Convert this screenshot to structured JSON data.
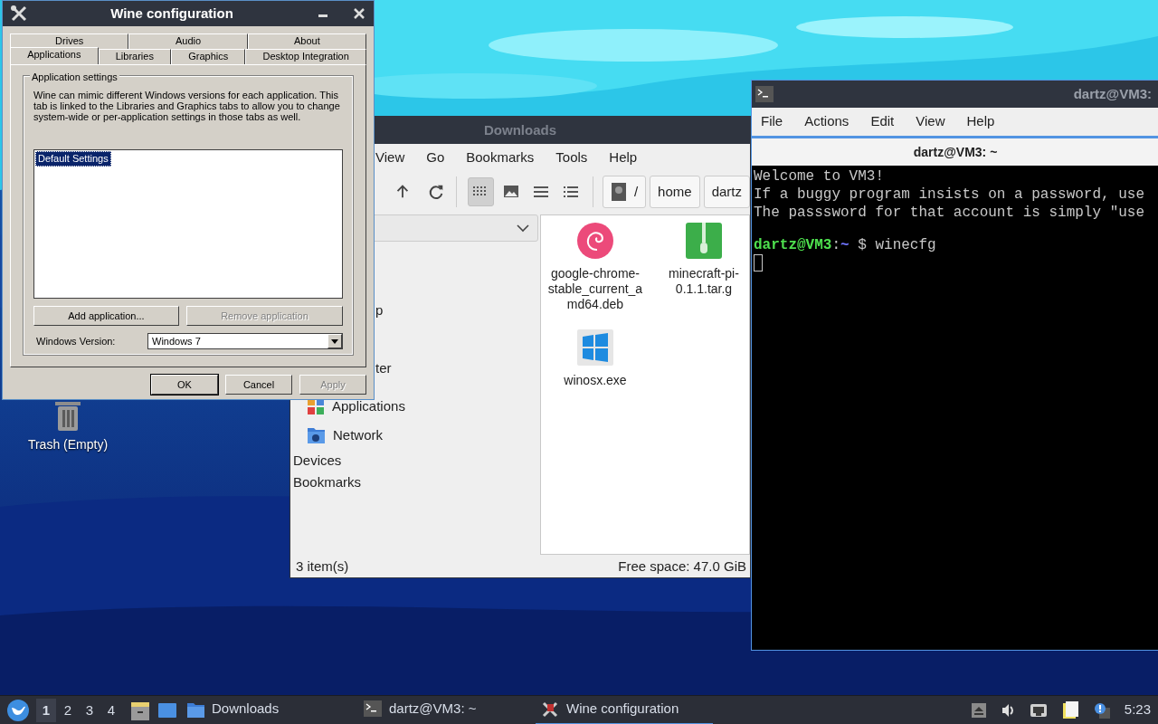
{
  "desktop_icons": [
    {
      "label": "Trash (Empty)",
      "kind": "trash"
    }
  ],
  "file_manager": {
    "title": "Downloads",
    "active": false,
    "menu": [
      "View",
      "Go",
      "Bookmarks",
      "Tools",
      "Help"
    ],
    "view_modes": [
      {
        "kind": "icons",
        "selected": true
      },
      {
        "kind": "thumbnails",
        "selected": false
      },
      {
        "kind": "compact",
        "selected": false
      },
      {
        "kind": "detailed",
        "selected": false
      }
    ],
    "path": [
      {
        "label": "/",
        "kind": "root"
      },
      {
        "label": "home",
        "kind": "folder"
      },
      {
        "label": "dartz",
        "kind": "folder"
      }
    ],
    "sidebar": [
      {
        "label": "p",
        "kind": "clipped"
      },
      {
        "label": "ter",
        "kind": "clipped"
      },
      {
        "label": "Applications",
        "kind": "applications"
      },
      {
        "label": "Network",
        "kind": "network"
      },
      {
        "label": "Devices",
        "kind": "header"
      },
      {
        "label": "Bookmarks",
        "kind": "header"
      }
    ],
    "files": [
      {
        "name": "google-chrome-stable_current_amd64.deb",
        "kind": "deb"
      },
      {
        "name": "minecraft-pi-0.1.1.tar.g",
        "kind": "archive"
      },
      {
        "name": "winosx.exe",
        "kind": "exe"
      }
    ],
    "status_left": "3 item(s)",
    "status_right": "Free space: 47.0 GiB"
  },
  "wine_window": {
    "title": "Wine configuration",
    "active": true,
    "tab_rows": [
      {
        "tabs": [
          {
            "label": "Drives",
            "selected": false
          },
          {
            "label": "Audio",
            "selected": false
          },
          {
            "label": "About",
            "selected": false
          }
        ]
      },
      {
        "tabs": [
          {
            "label": "Applications",
            "selected": true
          },
          {
            "label": "Libraries",
            "selected": false
          },
          {
            "label": "Graphics",
            "selected": false
          },
          {
            "label": "Desktop Integration",
            "selected": false
          }
        ]
      }
    ],
    "group_title": "Application settings",
    "description": "Wine can mimic different Windows versions for each application. This tab is linked to the Libraries and Graphics tabs to allow you to change system-wide or per-application settings in those tabs as well.",
    "applications": [
      {
        "label": "Default Settings",
        "selected": true
      }
    ],
    "buttons": [
      {
        "label": "Add application...",
        "disabled": false
      },
      {
        "label": "Remove application",
        "disabled": true
      }
    ],
    "version_label": "Windows Version:",
    "version_value": "Windows 7",
    "footer_buttons": [
      {
        "label": "OK",
        "disabled": false,
        "default": true
      },
      {
        "label": "Cancel",
        "disabled": false,
        "default": false
      },
      {
        "label": "Apply",
        "disabled": true,
        "default": false
      }
    ]
  },
  "terminal": {
    "title": "dartz@VM3:",
    "menu": [
      "File",
      "Actions",
      "Edit",
      "View",
      "Help"
    ],
    "tab": {
      "label": "dartz@VM3: ~",
      "selected": true
    },
    "output": [
      "Welcome to VM3!",
      "If a buggy program insists on a password, use",
      "The passsword for that account is simply \"use"
    ],
    "prompt": {
      "user_host": "dartz@VM3",
      "separator": ":",
      "path": "~",
      "command": "$ winecfg"
    }
  },
  "taskbar": {
    "workspaces": [
      {
        "label": "1",
        "selected": true
      },
      {
        "label": "2",
        "selected": false
      },
      {
        "label": "3",
        "selected": false
      },
      {
        "label": "4",
        "selected": false
      }
    ],
    "tasks": [
      {
        "label": "Downloads",
        "kind": "folder",
        "selected": false
      },
      {
        "label": "dartz@VM3: ~",
        "kind": "terminal",
        "selected": false
      },
      {
        "label": "Wine configuration",
        "kind": "wine",
        "selected": true
      }
    ],
    "clock": "5:23"
  }
}
